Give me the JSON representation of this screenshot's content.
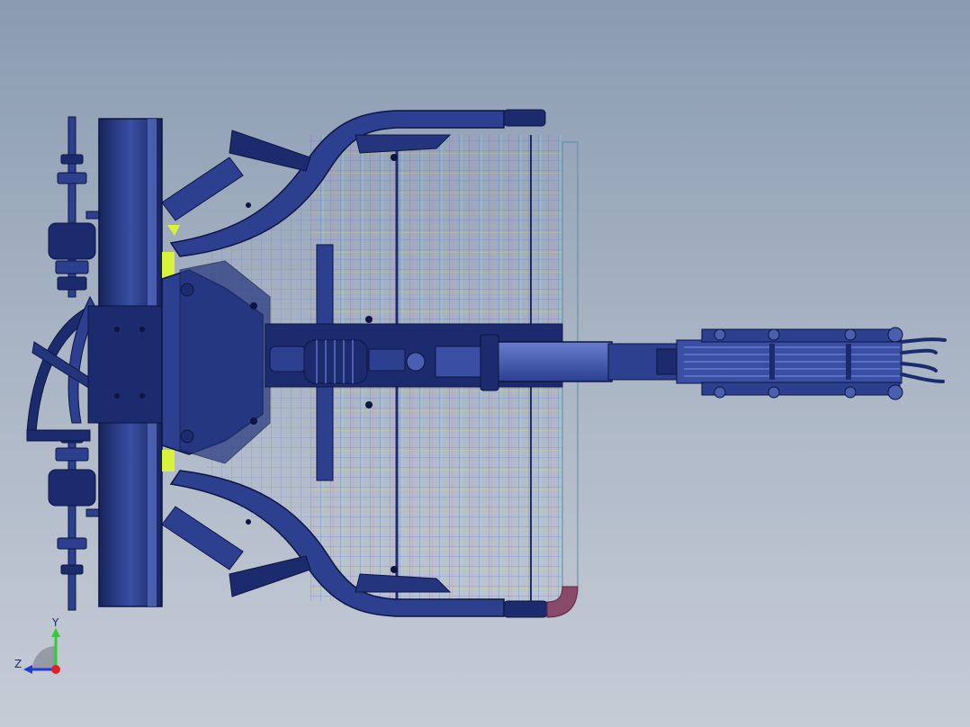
{
  "scene": {
    "colors": {
      "background_top": "#8a9bb2",
      "background_bottom": "#c6ccd6",
      "part_dark": "#1c2b6e",
      "part_mid": "#2d3f8f",
      "part_light": "#4a5fb0",
      "edge": "#0d1540",
      "highlight_yellow": "#d9f23a",
      "rail_cyan": "#a9d6e6",
      "rail_bend": "#8a4a6a"
    },
    "icons": [
      "triad-icon",
      "y-axis-arrow-icon",
      "z-axis-arrow-icon"
    ]
  },
  "triad": {
    "y_label": "Y",
    "z_label": "Z",
    "y_color": "#2bd12b",
    "z_color": "#1f3bd8",
    "origin_color": "#e0202a"
  }
}
